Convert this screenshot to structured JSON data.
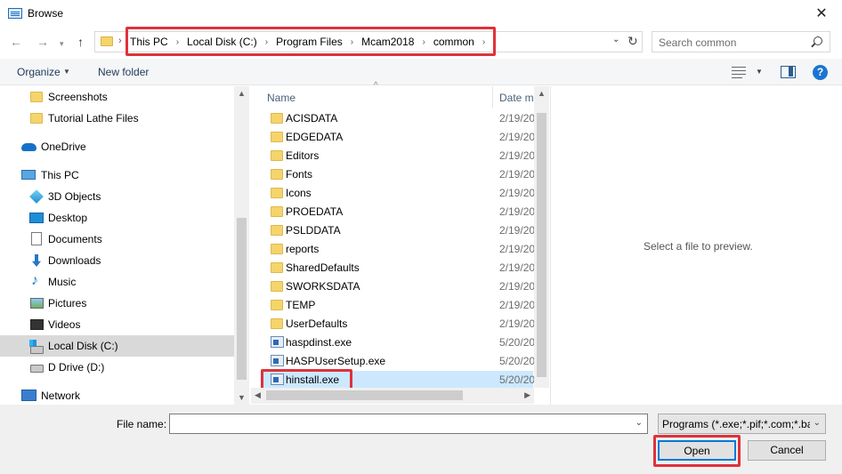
{
  "window": {
    "title": "Browse",
    "close_label": "✕"
  },
  "navigation": {
    "back_glyph": "←",
    "forward_glyph": "→",
    "recent_glyph": "▾",
    "up_glyph": "↑",
    "breadcrumbs": [
      "This PC",
      "Local Disk (C:)",
      "Program Files",
      "Mcam2018",
      "common"
    ],
    "separator": "›",
    "dropdown_glyph": "⌄",
    "refresh_glyph": "↻",
    "search_placeholder": "Search common"
  },
  "toolbar": {
    "organize_label": "Organize",
    "organize_arrow": "▼",
    "new_folder_label": "New folder",
    "view_arrow": "▼",
    "help_label": "?"
  },
  "sidebar": {
    "items": [
      {
        "label": "Screenshots",
        "icon": "folder-icon"
      },
      {
        "label": "Tutorial Lathe Files",
        "icon": "folder-icon"
      },
      {
        "label": "OneDrive",
        "icon": "onedrive-icon"
      },
      {
        "label": "This PC",
        "icon": "computer-icon"
      },
      {
        "label": "3D Objects",
        "icon": "3d-objects-icon"
      },
      {
        "label": "Desktop",
        "icon": "desktop-icon"
      },
      {
        "label": "Documents",
        "icon": "documents-icon"
      },
      {
        "label": "Downloads",
        "icon": "downloads-icon"
      },
      {
        "label": "Music",
        "icon": "music-icon"
      },
      {
        "label": "Pictures",
        "icon": "pictures-icon"
      },
      {
        "label": "Videos",
        "icon": "videos-icon"
      },
      {
        "label": "Local Disk (C:)",
        "icon": "local-disk-icon",
        "selected": true
      },
      {
        "label": "D Drive (D:)",
        "icon": "drive-icon"
      },
      {
        "label": "Network",
        "icon": "network-icon"
      }
    ]
  },
  "file_list": {
    "columns": {
      "name": "Name",
      "date": "Date m",
      "sort_arrow": "^"
    },
    "rows": [
      {
        "name": "ACISDATA",
        "date": "2/19/20",
        "type": "folder"
      },
      {
        "name": "EDGEDATA",
        "date": "2/19/20",
        "type": "folder"
      },
      {
        "name": "Editors",
        "date": "2/19/20",
        "type": "folder"
      },
      {
        "name": "Fonts",
        "date": "2/19/20",
        "type": "folder"
      },
      {
        "name": "Icons",
        "date": "2/19/20",
        "type": "folder"
      },
      {
        "name": "PROEDATA",
        "date": "2/19/20",
        "type": "folder"
      },
      {
        "name": "PSLDDATA",
        "date": "2/19/20",
        "type": "folder"
      },
      {
        "name": "reports",
        "date": "2/19/20",
        "type": "folder"
      },
      {
        "name": "SharedDefaults",
        "date": "2/19/20",
        "type": "folder"
      },
      {
        "name": "SWORKSDATA",
        "date": "2/19/20",
        "type": "folder"
      },
      {
        "name": "TEMP",
        "date": "2/19/20",
        "type": "folder"
      },
      {
        "name": "UserDefaults",
        "date": "2/19/20",
        "type": "folder"
      },
      {
        "name": "haspdinst.exe",
        "date": "5/20/20",
        "type": "exe"
      },
      {
        "name": "HASPUserSetup.exe",
        "date": "5/20/20",
        "type": "exe"
      },
      {
        "name": "hinstall.exe",
        "date": "5/20/20",
        "type": "exe",
        "selected": true
      }
    ]
  },
  "preview": {
    "message": "Select a file to preview."
  },
  "bottom": {
    "file_name_label": "File name:",
    "file_name_value": "",
    "file_type_value": "Programs (*.exe;*.pif;*.com;*.ba",
    "dropdown_glyph": "⌄",
    "open_label": "Open",
    "cancel_label": "Cancel"
  },
  "colors": {
    "highlight": "#e0313a",
    "selection": "#cce8ff",
    "accent": "#0078d7"
  }
}
